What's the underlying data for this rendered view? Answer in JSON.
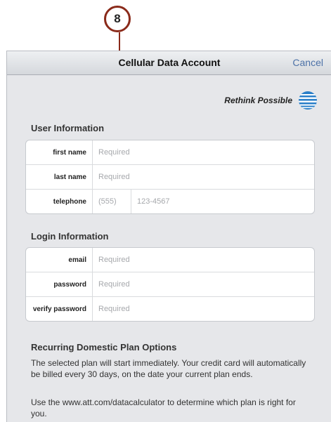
{
  "callout": {
    "number": "8"
  },
  "navbar": {
    "title": "Cellular Data Account",
    "cancel_label": "Cancel"
  },
  "brand": {
    "tagline": "Rethink Possible",
    "logo_icon": "att-globe-icon"
  },
  "user_information": {
    "heading": "User Information",
    "first_name": {
      "label": "first name",
      "placeholder": "Required"
    },
    "last_name": {
      "label": "last name",
      "placeholder": "Required"
    },
    "telephone": {
      "label": "telephone",
      "area_placeholder": "(555)",
      "number_placeholder": "123-4567"
    }
  },
  "login_information": {
    "heading": "Login Information",
    "email": {
      "label": "email",
      "placeholder": "Required"
    },
    "password": {
      "label": "password",
      "placeholder": "Required"
    },
    "verify_password": {
      "label": "verify password",
      "placeholder": "Required"
    }
  },
  "plan_options": {
    "heading": "Recurring Domestic Plan Options",
    "paragraph1": "The selected plan will start immediately. Your credit card will automatically be billed every 30 days, on the date your current plan ends.",
    "paragraph2": "Use the www.att.com/datacalculator to determine which plan is right for you."
  },
  "colors": {
    "callout": "#8a2a1a",
    "link": "#4d72a8",
    "background": "#e6e7ea"
  }
}
